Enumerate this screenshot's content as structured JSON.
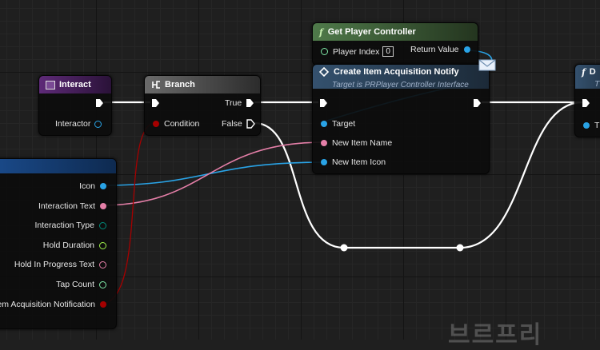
{
  "nodes": {
    "interact": {
      "title": "Interact",
      "pins": {
        "interactor": "Interactor"
      }
    },
    "branch": {
      "title": "Branch",
      "pins": {
        "condition": "Condition",
        "true_label": "True",
        "false_label": "False"
      }
    },
    "get_player_controller": {
      "title": "Get Player Controller",
      "pins": {
        "player_index": "Player Index",
        "player_index_value": "0",
        "return_value": "Return Value"
      }
    },
    "create_notify": {
      "title": "Create Item Acquisition Notify",
      "subtitle": "Target is PRPlayer Controller Interface",
      "pins": {
        "target": "Target",
        "new_item_name": "New Item Name",
        "new_item_icon": "New Item Icon"
      }
    },
    "struct_break": {
      "pins": {
        "icon": "Icon",
        "interaction_text": "Interaction Text",
        "interaction_type": "Interaction Type",
        "hold_duration": "Hold Duration",
        "hold_in_progress_text": "Hold In Progress Text",
        "tap_count": "Tap Count",
        "item_acquisition_notification": "em Acquisition Notification"
      }
    },
    "right_node": {
      "title_fragment": "D",
      "subtitle_fragment": "T",
      "pin_fragment": "T"
    }
  },
  "icons": {
    "function": "f",
    "event": "event-icon",
    "branch": "branch-icon",
    "interface": "interface-icon",
    "message": "envelope-icon"
  },
  "colors": {
    "object_pin": "#29a3e6",
    "text_pin": "#e57fa8",
    "byte_pin": "#008a7a",
    "float_pin": "#9ff24a",
    "text_green": "#7ee8a6",
    "bool_pin": "#a50000",
    "exec": "#ffffff"
  },
  "watermark": "브르프리"
}
